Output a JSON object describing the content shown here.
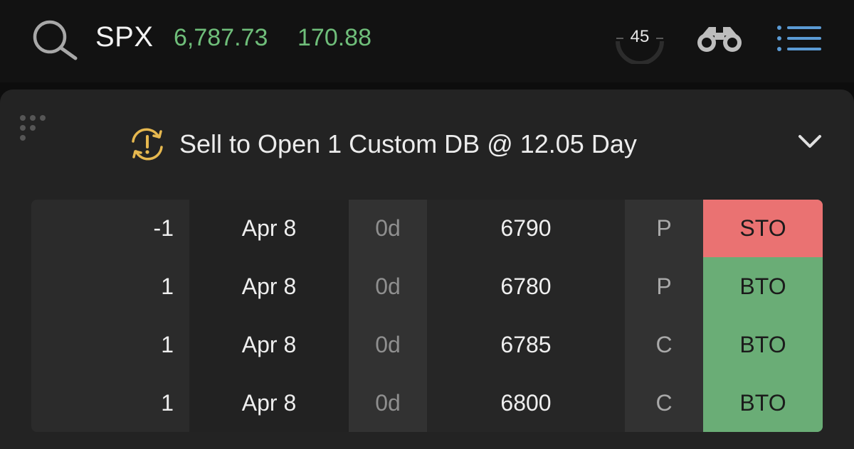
{
  "header": {
    "symbol": "SPX",
    "price": "6,787.73",
    "change": "170.88",
    "gauge_value": "45",
    "icons": {
      "search": "search-icon",
      "binoculars": "binoculars-icon",
      "menu": "list-menu-icon"
    }
  },
  "order": {
    "summary": "Sell to Open 1 Custom DB @ 12.05 Day",
    "status_icon": "alert-cycle-icon",
    "collapse_icon": "chevron-down-icon"
  },
  "legs": [
    {
      "qty": "-1",
      "date": "Apr 8",
      "dte": "0d",
      "strike": "6790",
      "type": "P",
      "action": "STO"
    },
    {
      "qty": "1",
      "date": "Apr 8",
      "dte": "0d",
      "strike": "6780",
      "type": "P",
      "action": "BTO"
    },
    {
      "qty": "1",
      "date": "Apr 8",
      "dte": "0d",
      "strike": "6785",
      "type": "C",
      "action": "BTO"
    },
    {
      "qty": "1",
      "date": "Apr 8",
      "dte": "0d",
      "strike": "6800",
      "type": "C",
      "action": "BTO"
    }
  ],
  "colors": {
    "background": "#0d0d0d",
    "panel": "#232323",
    "price_green": "#6fbe7a",
    "sell_red": "#ea7272",
    "buy_green": "#6aad76",
    "warning_yellow": "#e6b84f",
    "menu_blue": "#5b9bd5"
  }
}
